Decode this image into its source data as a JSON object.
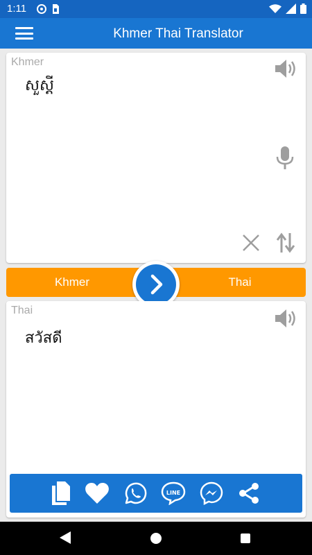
{
  "status_bar": {
    "time": "1:11",
    "icons": [
      "sync-icon",
      "sim-card-icon",
      "wifi-icon",
      "signal-icon",
      "battery-icon"
    ]
  },
  "app_bar": {
    "title": "Khmer Thai Translator",
    "menu_icon": "hamburger-menu-icon"
  },
  "source_panel": {
    "language_label": "Khmer",
    "text": "សួស្តី",
    "icons": [
      "speaker-icon",
      "microphone-icon",
      "clear-icon",
      "swap-icon"
    ]
  },
  "language_bar": {
    "source_language": "Khmer",
    "target_language": "Thai",
    "translate_icon": "chevron-right-icon"
  },
  "target_panel": {
    "language_label": "Thai",
    "text": "สวัสดี",
    "icons": [
      "speaker-icon"
    ],
    "actions": [
      "copy-icon",
      "favorite-icon",
      "whatsapp-icon",
      "line-icon",
      "messenger-icon",
      "share-icon"
    ]
  },
  "colors": {
    "primary": "#1976d2",
    "status_bar": "#1565c0",
    "accent": "#ff9800",
    "label_gray": "#aaaaaa",
    "icon_gray": "#9e9e9e"
  },
  "nav_bar": {
    "icons": [
      "back-icon",
      "home-icon",
      "recents-icon"
    ]
  }
}
